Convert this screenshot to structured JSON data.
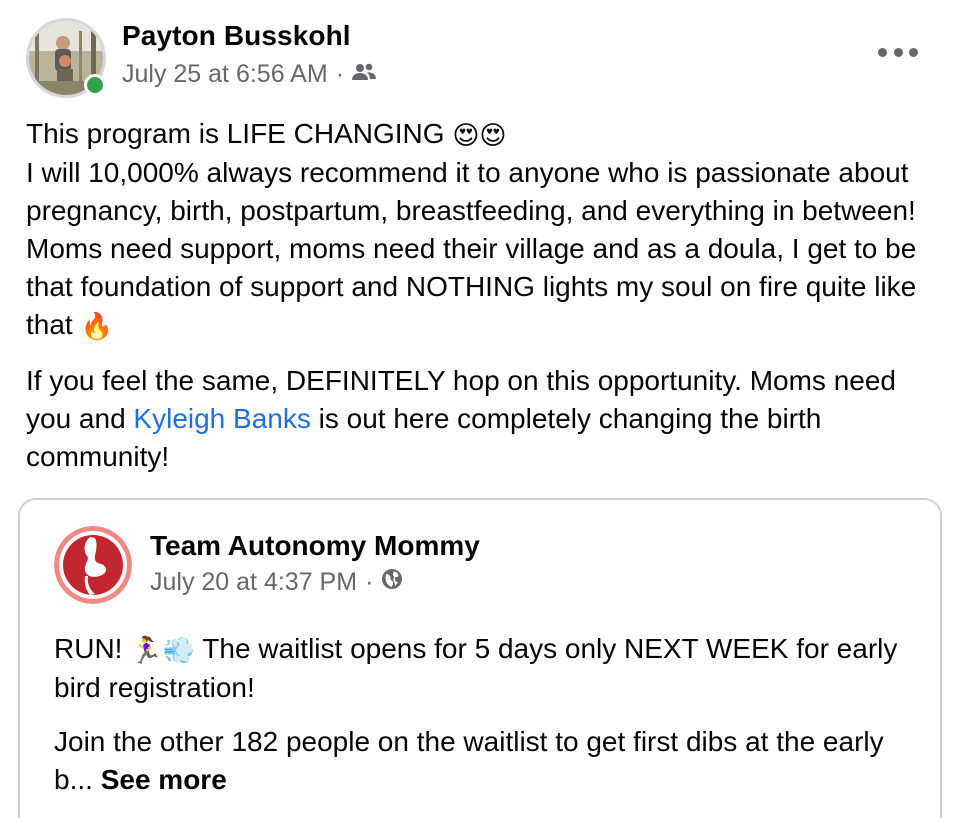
{
  "post": {
    "author": "Payton Busskohl",
    "timestamp": "July 25 at 6:56 AM",
    "separator": "·",
    "audience_icon": "friends-icon",
    "online": true,
    "more_icon": "more-options-icon",
    "paragraph1_line1": "This program is LIFE CHANGING",
    "paragraph1_emoji1": "😍😍",
    "paragraph1_rest": "I will 10,000% always recommend it to anyone who is passionate about pregnancy, birth, postpartum, breastfeeding, and everything in between! Moms need support, moms need their village and as a doula, I get to be that foundation of support and NOTHING lights my soul on fire quite like that",
    "paragraph1_emoji2": "🔥",
    "paragraph2_before": "If you feel the same, DEFINITELY hop on this opportunity. Moms need you and",
    "paragraph2_link": "Kyleigh Banks",
    "paragraph2_after": "is out here completely changing the birth community!"
  },
  "shared": {
    "page_name": "Team Autonomy Mommy",
    "timestamp": "July 20 at 4:37 PM",
    "separator": "·",
    "audience_icon": "globe-icon",
    "line1_before": "RUN!",
    "line1_emoji": "🏃‍♀️💨",
    "line1_after": "The waitlist opens for 5 days only NEXT WEEK for early bird registration!",
    "line2": "Join the other 182 people on the waitlist to get first dibs at the early b...",
    "see_more": "See more"
  },
  "colors": {
    "link": "#216fdb",
    "secondary_text": "#65676b",
    "online": "#31a24c",
    "logo_red": "#c2272f"
  }
}
